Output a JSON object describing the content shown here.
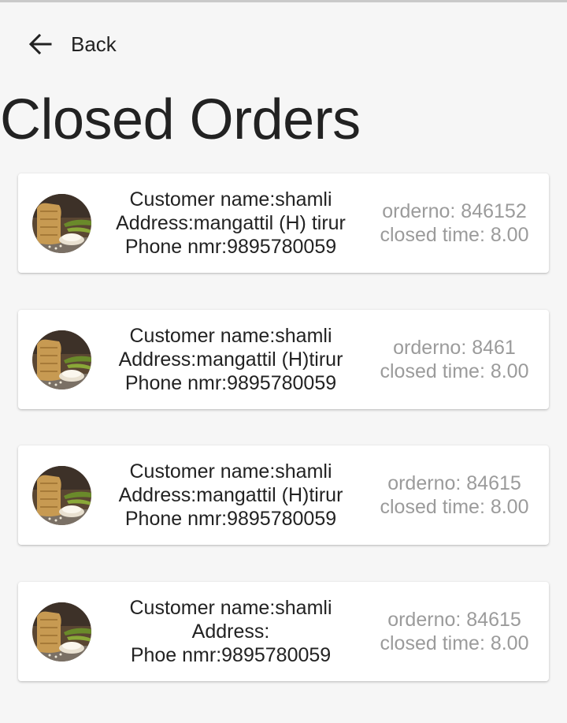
{
  "header": {
    "back_label": "Back",
    "title": "Closed Orders"
  },
  "orders": [
    {
      "customer": "Customer name:shamli",
      "address": "Address:mangattil (H) tirur",
      "phone": "Phone nmr:9895780059",
      "order_no": "orderno: 846152",
      "closed_time": "closed time: 8.00"
    },
    {
      "customer": "Customer name:shamli",
      "address": "Address:mangattil (H)tirur",
      "phone": "Phone nmr:9895780059",
      "order_no": "orderno: 8461",
      "closed_time": "closed time: 8.00"
    },
    {
      "customer": "Customer name:shamli",
      "address": "Address:mangattil (H)tirur",
      "phone": "Phone nmr:9895780059",
      "order_no": "orderno: 84615",
      "closed_time": "closed time: 8.00"
    },
    {
      "customer": "Customer name:shamli",
      "address": "Address:",
      "phone": "Phoe nmr:9895780059",
      "order_no": "orderno: 84615",
      "closed_time": "closed time: 8.00"
    }
  ],
  "icons": {
    "back": "arrow-left-icon",
    "product": "rice-sack-image"
  },
  "colors": {
    "background": "#f6f6f6",
    "card": "#ffffff",
    "primary_text": "#222222",
    "secondary_text": "#9b9b9b"
  }
}
